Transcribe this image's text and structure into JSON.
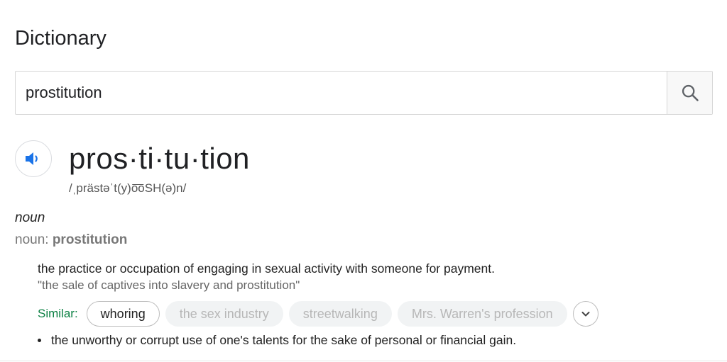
{
  "section_title": "Dictionary",
  "search": {
    "value": "prostitution",
    "icon": "search-icon"
  },
  "entry": {
    "speaker_icon": "speaker-icon",
    "headword": "pros·ti·tu·tion",
    "phonetic": "/ˌprästəˈt(y)o͞oSH(ə)n/",
    "part_of_speech": "noun",
    "pos_prefix": "noun: ",
    "pos_word": "prostitution",
    "definitions": [
      {
        "text": "the practice or occupation of engaging in sexual activity with someone for payment.",
        "example": "\"the sale of captives into slavery and prostitution\""
      },
      {
        "text": "the unworthy or corrupt use of one's talents for the sake of personal or financial gain."
      }
    ],
    "similar_label": "Similar:",
    "similar": [
      "whoring",
      "the sex industry",
      "streetwalking",
      "Mrs. Warren's profession"
    ],
    "expand_icon": "chevron-down-icon"
  },
  "colors": {
    "similar_label": "#0b8043",
    "speaker_blue": "#1a73e8"
  }
}
